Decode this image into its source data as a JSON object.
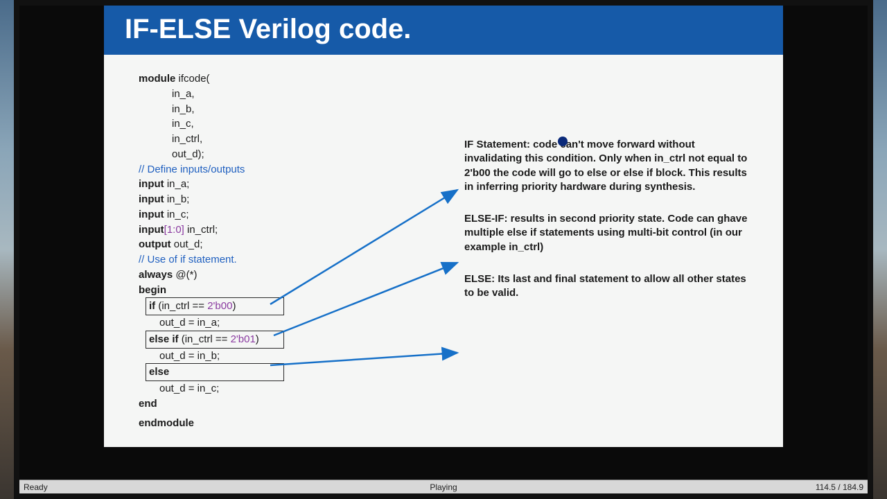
{
  "title": "IF-ELSE Verilog code.",
  "code": {
    "module_kw": "module",
    "module_name": " ifcode(",
    "ports": [
      "in_a,",
      "in_b,",
      "in_c,",
      "in_ctrl,",
      "out_d);"
    ],
    "comment_io": "// Define inputs/outputs",
    "input_kw": "input",
    "in_a": " in_a;",
    "in_b": " in_b;",
    "in_c": " in_c;",
    "range": "[1:0]",
    "in_ctrl": " in_ctrl;",
    "output_kw": "output",
    "out_d": " out_d;",
    "comment_use": "// Use of if statement.",
    "always_kw": "always",
    "always_rest": " @(*)",
    "begin_kw": "begin",
    "if_kw": "if",
    "if_cond_a": " (in_ctrl == ",
    "lit00": "2'b00",
    "if_cond_b": ")",
    "assign_a": "out_d = in_a;",
    "elseif_kw": "else if",
    "elseif_cond_a": " (in_ctrl == ",
    "lit01": "2'b01",
    "elseif_cond_b": ")",
    "assign_b": "out_d = in_b;",
    "else_kw": "else",
    "assign_c": "out_d = in_c;",
    "end_kw": "end",
    "endmodule_kw": "endmodule"
  },
  "annotations": {
    "if": "IF Statement: code can't move forward without invalidating this condition. Only when in_ctrl not equal to 2'b00 the code will go to else or else if block. This results in inferring priority hardware during synthesis.",
    "elseif": "ELSE-IF: results in second priority state. Code can ghave multiple else if statements using multi-bit control (in our example in_ctrl)",
    "else": "ELSE: Its last and final statement to allow all other states to be valid."
  },
  "status": {
    "left": "Ready",
    "center": "Playing",
    "right": "114.5 / 184.9"
  }
}
